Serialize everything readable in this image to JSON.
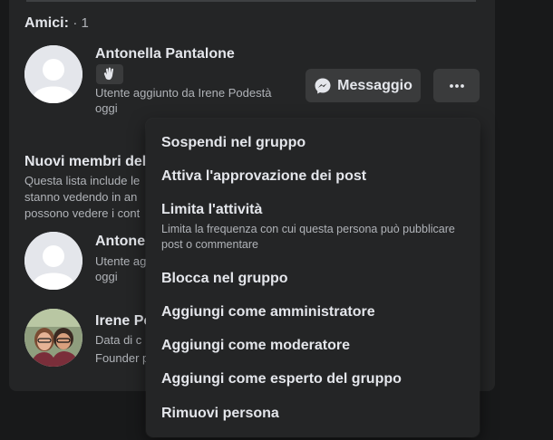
{
  "friends": {
    "title": "Amici:",
    "count": "· 1",
    "member": {
      "name": "Antonella Pantalone",
      "added_line1": "Utente aggiunto da Irene Podestà",
      "added_line2": "oggi",
      "message_label": "Messaggio"
    }
  },
  "new_members": {
    "title": "Nuovi membri del",
    "desc_line1": "Questa lista include le",
    "desc_line2": "stanno vedendo in an",
    "desc_line3": "possono vedere i cont",
    "members": [
      {
        "name": "Antonel",
        "line1": "Utente ag",
        "line2": "oggi"
      },
      {
        "name": "Irene Po",
        "line1": "Data di c",
        "line2": "Founder p"
      }
    ]
  },
  "menu": {
    "items": [
      {
        "label": "Sospendi nel gruppo"
      },
      {
        "label": "Attiva l'approvazione dei post"
      },
      {
        "label": "Limita l'attività",
        "sub": "Limita la frequenza con cui questa persona può pubblicare post o commentare"
      },
      {
        "label": "Blocca nel gruppo"
      },
      {
        "label": "Aggiungi come amministratore"
      },
      {
        "label": "Aggiungi come moderatore"
      },
      {
        "label": "Aggiungi come esperto del gruppo"
      },
      {
        "label": "Rimuovi persona"
      }
    ]
  },
  "colors": {
    "background": "#18191a",
    "card": "#242526",
    "button": "#3a3b3c",
    "text_primary": "#e4e6eb",
    "text_secondary": "#b0b3b8"
  },
  "icons": {
    "wave": "waving-hand-icon",
    "messenger": "messenger-icon",
    "more": "more-horizontal-icon"
  }
}
